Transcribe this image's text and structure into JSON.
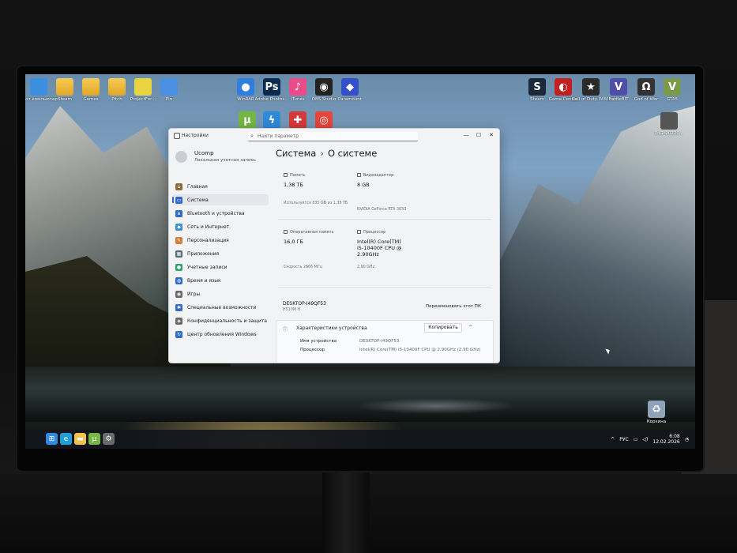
{
  "desktop": {
    "icons_left": [
      {
        "label": "Этот компьютер",
        "icon": "pc-icon",
        "color": "#3c8ee0"
      },
      {
        "label": "Steam",
        "icon": "folder-icon",
        "color": "#f2c14e"
      },
      {
        "label": "Games",
        "icon": "folder-icon",
        "color": "#f2c14e"
      },
      {
        "label": "Pitch",
        "icon": "folder-icon",
        "color": "#f2c14e"
      },
      {
        "label": "ProjectFor...",
        "icon": "usb-icon",
        "color": "#e8d441"
      },
      {
        "label": "Pin",
        "icon": "undo-icon",
        "color": "#4a90e2"
      }
    ],
    "icons_center_top": [
      {
        "label": "WinRAR",
        "icon": "map-pin-icon",
        "color": "#2f7fe0",
        "glyph": "●"
      },
      {
        "label": "Adobe Photos...",
        "icon": "photoshop-icon",
        "color": "#0b2b4e",
        "glyph": "Ps"
      },
      {
        "label": "iTunes",
        "icon": "itunes-icon",
        "color": "#ea4c89",
        "glyph": "♪"
      },
      {
        "label": "OBS Studio",
        "icon": "obs-icon",
        "color": "#222222",
        "glyph": "◉"
      },
      {
        "label": "Paramount",
        "icon": "cube-icon",
        "color": "#3350c9",
        "glyph": "◆"
      }
    ],
    "icons_center_second": [
      {
        "label": "",
        "icon": "utorrent-icon",
        "color": "#74b743",
        "glyph": "µ"
      },
      {
        "label": "",
        "icon": "bolt-icon",
        "color": "#2f8ad8",
        "glyph": "ϟ"
      },
      {
        "label": "",
        "icon": "game-launcher-icon",
        "color": "#d43a3a",
        "glyph": "✚"
      },
      {
        "label": "",
        "icon": "chrome-icon",
        "color": "#e8453c",
        "glyph": "◎"
      }
    ],
    "icons_right": [
      {
        "label": "Steam",
        "icon": "steam-icon",
        "color": "#1b2838",
        "glyph": "S"
      },
      {
        "label": "Game Center",
        "icon": "game-center-icon",
        "color": "#c21f1f",
        "glyph": "◐"
      },
      {
        "label": "Call of Duty WWII",
        "icon": "cod-icon",
        "color": "#2a2a2a",
        "glyph": "★"
      },
      {
        "label": "BattleBIT",
        "icon": "v-icon",
        "color": "#4f4fa8",
        "glyph": "V"
      },
      {
        "label": "God of War",
        "icon": "gow-icon",
        "color": "#333333",
        "glyph": "Ω"
      },
      {
        "label": "GTA5",
        "icon": "gta-icon",
        "color": "#7a9a4a",
        "glyph": "V"
      }
    ],
    "icon_right_second": {
      "label": "IMG_20220...",
      "icon": "image-file-icon",
      "color": "#555555"
    },
    "recycle_bin": {
      "label": "Корзина",
      "icon": "recycle-bin-icon"
    }
  },
  "taskbar": {
    "pinned": [
      {
        "icon": "windows-start-icon",
        "color": "#2f8ae0",
        "glyph": "⊞"
      },
      {
        "icon": "edge-icon",
        "color": "#1f9ed8",
        "glyph": "e"
      },
      {
        "icon": "explorer-folder-icon",
        "color": "#f2c14e",
        "glyph": "▬"
      },
      {
        "icon": "utorrent-icon",
        "color": "#74b743",
        "glyph": "µ"
      },
      {
        "icon": "settings-gear-icon",
        "color": "#6a6a6a",
        "glyph": "⚙"
      }
    ],
    "tray": {
      "chevron": "^",
      "lang": "РУС",
      "time": "6:08",
      "date": "12.02.2026"
    }
  },
  "window": {
    "title": "Настройки",
    "search_placeholder": "Найти параметр",
    "controls": {
      "minimize": "—",
      "maximize": "☐",
      "close": "✕"
    },
    "user": {
      "name": "Ucomp",
      "type": "Локальная учетная запись"
    },
    "nav": [
      {
        "label": "Главная",
        "icon": "home-icon",
        "color": "#8a6d3b",
        "glyph": "⌂",
        "active": false
      },
      {
        "label": "Система",
        "icon": "system-icon",
        "color": "#2f6bc9",
        "glyph": "▭",
        "active": true
      },
      {
        "label": "Bluetooth и устройства",
        "icon": "bluetooth-icon",
        "color": "#2f6bc9",
        "glyph": "ʙ",
        "active": false
      },
      {
        "label": "Сеть и Интернет",
        "icon": "wifi-icon",
        "color": "#3b8fd1",
        "glyph": "◆",
        "active": false
      },
      {
        "label": "Персонализация",
        "icon": "brush-icon",
        "color": "#d47d34",
        "glyph": "✎",
        "active": false
      },
      {
        "label": "Приложения",
        "icon": "apps-icon",
        "color": "#5a6a7a",
        "glyph": "▦",
        "active": false
      },
      {
        "label": "Учетные записи",
        "icon": "accounts-icon",
        "color": "#2fa36b",
        "glyph": "●",
        "active": false
      },
      {
        "label": "Время и язык",
        "icon": "globe-icon",
        "color": "#2f6bc9",
        "glyph": "◍",
        "active": false
      },
      {
        "label": "Игры",
        "icon": "gamepad-icon",
        "color": "#6a6a6a",
        "glyph": "◉",
        "active": false
      },
      {
        "label": "Специальные возможности",
        "icon": "accessibility-icon",
        "color": "#2f6bc9",
        "glyph": "✱",
        "active": false
      },
      {
        "label": "Конфиденциальность и защита",
        "icon": "shield-icon",
        "color": "#6a6a6a",
        "glyph": "◈",
        "active": false
      },
      {
        "label": "Центр обновления Windows",
        "icon": "update-icon",
        "color": "#2f6bc9",
        "glyph": "↻",
        "active": false
      }
    ],
    "breadcrumb": {
      "parent": "Система",
      "separator": "›",
      "current": "О системе"
    },
    "specs": {
      "storage_label": "Память",
      "storage_value": "1,38 ТБ",
      "storage_sub": "Используется 835 GB из 1,38 ТБ",
      "gpu_label": "Видеоадаптер",
      "gpu_value": "8 GB",
      "gpu_sub": "NVIDIA GeForce RTX 3050",
      "ram_label": "Оперативная память",
      "ram_value": "16,0 ГБ",
      "ram_sub": "Скорость 2666 МГц",
      "cpu_label": "Процессор",
      "cpu_value_1": "Intel(R) Core(TM)",
      "cpu_value_2": "i5-10400F CPU @",
      "cpu_value_3": "2.90GHz",
      "cpu_sub": "2,90 GHz"
    },
    "device": {
      "name": "DESKTOP-I49QF53",
      "model": "H510M H",
      "rename_label": "Переименовать этот ПК"
    },
    "device_specs": {
      "title": "Характеристики устройства",
      "copy_label": "Копировать",
      "chevron": "^",
      "rows": [
        {
          "key": "Имя устройства",
          "value": "DESKTOP-I49QF53"
        },
        {
          "key": "Процессор",
          "value": "Intel(R) Core(TM) i5-10400F CPU @ 2.90GHz (2.90 GHz)"
        }
      ]
    }
  }
}
